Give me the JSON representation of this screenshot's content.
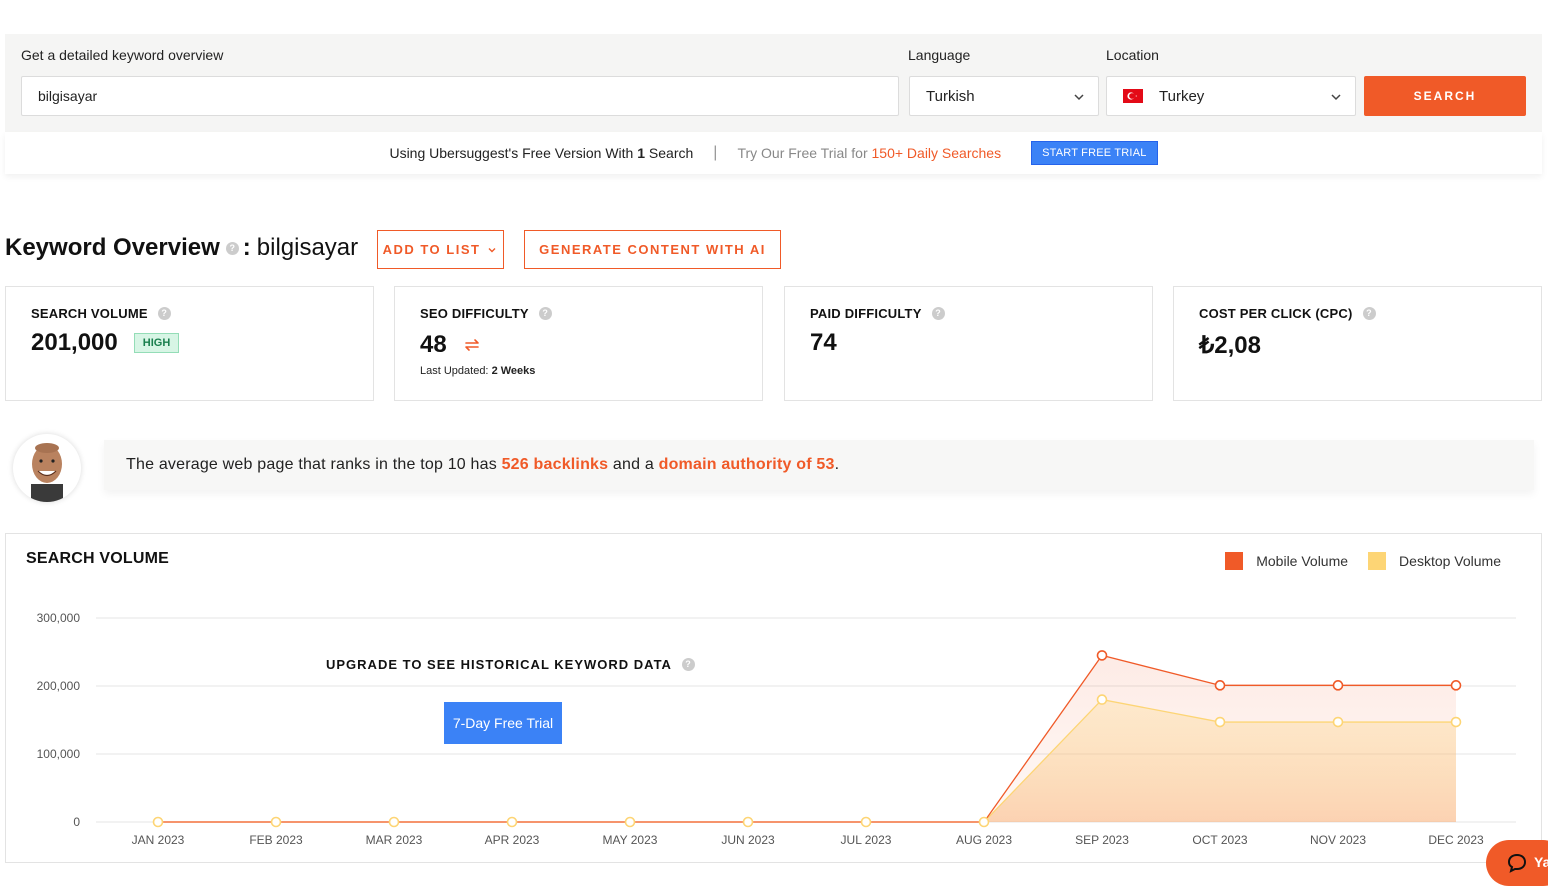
{
  "search": {
    "label": "Get a detailed keyword overview",
    "keyword_value": "bilgisayar",
    "language_label": "Language",
    "language_value": "Turkish",
    "location_label": "Location",
    "location_value": "Turkey",
    "search_button": "SEARCH"
  },
  "free_bar": {
    "text_prefix": "Using Ubersuggest's Free Version With ",
    "count": "1",
    "text_suffix": " Search",
    "separator": "|",
    "trial_prefix": "Try Our Free Trial for ",
    "trial_highlight": "150+ Daily Searches",
    "trial_button": "START FREE TRIAL"
  },
  "overview": {
    "title": "Keyword Overview",
    "colon": ":",
    "keyword": "bilgisayar",
    "add_to_list": "ADD TO LIST",
    "generate_ai": "GENERATE CONTENT WITH AI"
  },
  "cards": {
    "search_volume": {
      "title": "SEARCH VOLUME",
      "value": "201,000",
      "badge": "HIGH"
    },
    "seo_difficulty": {
      "title": "SEO DIFFICULTY",
      "value": "48",
      "updated_label": "Last Updated: ",
      "updated_value": "2 Weeks"
    },
    "paid_difficulty": {
      "title": "PAID DIFFICULTY",
      "value": "74"
    },
    "cpc": {
      "title": "COST PER CLICK (CPC)",
      "value": "₺2,08"
    }
  },
  "tip": {
    "prefix": "The average web page that ranks in the top 10 has ",
    "backlinks": "526 backlinks",
    "middle": " and a ",
    "authority": "domain authority of 53",
    "suffix": "."
  },
  "chart_section": {
    "title": "SEARCH VOLUME",
    "legend_mobile": "Mobile Volume",
    "legend_desktop": "Desktop Volume",
    "upgrade_text": "UPGRADE TO SEE HISTORICAL KEYWORD DATA",
    "trial_button": "7-Day Free Trial",
    "mobile_color": "#f05a28",
    "desktop_color": "#fdd575"
  },
  "chart_data": {
    "type": "line",
    "x": [
      "JAN 2023",
      "FEB 2023",
      "MAR 2023",
      "APR 2023",
      "MAY 2023",
      "JUN 2023",
      "JUL 2023",
      "AUG 2023",
      "SEP 2023",
      "OCT 2023",
      "NOV 2023",
      "DEC 2023"
    ],
    "y_ticks": [
      "0",
      "100,000",
      "200,000",
      "300,000"
    ],
    "ylim": [
      0,
      300000
    ],
    "series": [
      {
        "name": "Mobile Volume",
        "values": [
          0,
          0,
          0,
          0,
          0,
          0,
          0,
          0,
          245000,
          201000,
          201000,
          201000
        ]
      },
      {
        "name": "Desktop Volume",
        "values": [
          0,
          0,
          0,
          0,
          0,
          0,
          0,
          0,
          180000,
          147000,
          147000,
          147000
        ]
      }
    ],
    "legend": "top-right",
    "grid": true
  },
  "chat": {
    "label": "Ya"
  }
}
